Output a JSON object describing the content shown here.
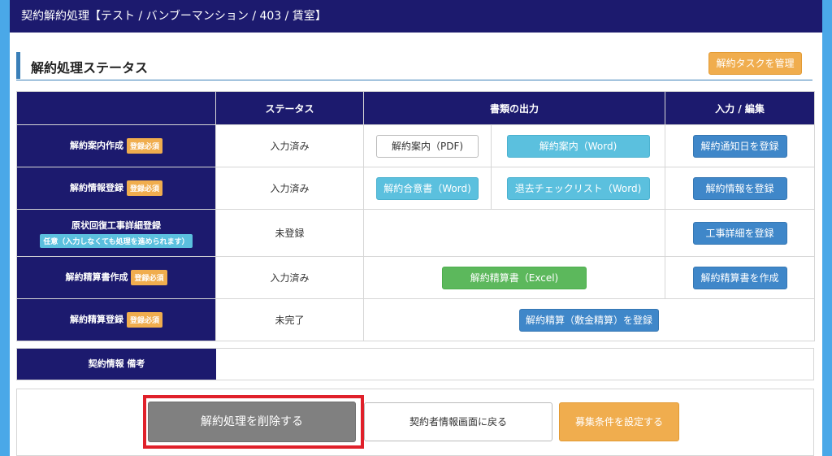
{
  "window": {
    "title": "契約解約処理【テスト / バンブーマンション / 403 / 賃室】"
  },
  "section": {
    "title": "解約処理ステータス",
    "manage_button": "解約タスクを管理"
  },
  "table": {
    "headers": [
      "",
      "ステータス",
      "書類の出力",
      "入力 / 編集"
    ],
    "required_badge": "登録必須",
    "optional_badge": "任意（入力しなくても処理を進められます）",
    "rows": [
      {
        "label": "解約案内作成",
        "status": "入力済み",
        "doc_buttons": [
          "解約案内（PDF)",
          "解約案内（Word)"
        ],
        "edit_button": "解約通知日を登録"
      },
      {
        "label": "解約情報登録",
        "status": "入力済み",
        "doc_buttons": [
          "解約合意書（Word)",
          "退去チェックリスト（Word)"
        ],
        "edit_button": "解約情報を登録"
      },
      {
        "label": "原状回復工事詳細登録",
        "status": "未登録",
        "edit_button": "工事詳細を登録"
      },
      {
        "label": "解約精算書作成",
        "status": "入力済み",
        "doc_buttons": [
          "解約精算書（Excel)"
        ],
        "edit_button": "解約精算書を作成"
      },
      {
        "label": "解約精算登録",
        "status": "未完了",
        "wide_button": "解約精算（敷金精算）を登録"
      }
    ]
  },
  "notes": {
    "label": "契約情報 備考"
  },
  "footer": {
    "delete_button": "解約処理を削除する",
    "back_button": "契約者情報画面に戻る",
    "conditions_button": "募集条件を設定する"
  }
}
